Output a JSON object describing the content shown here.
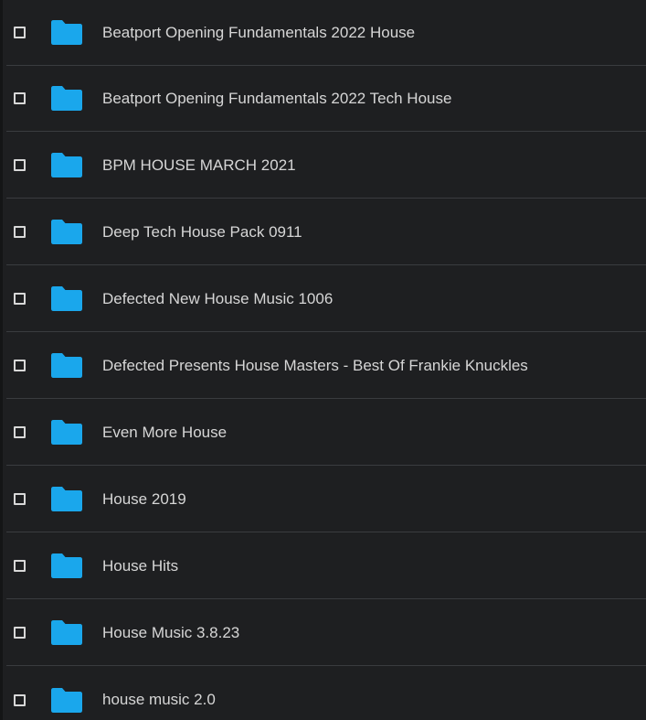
{
  "colors": {
    "background": "#1e1f21",
    "folder": "#1aa7ec",
    "text": "#d6d6d6",
    "divider": "#3a3c3f"
  },
  "list": {
    "items": [
      {
        "name": "Beatport Opening Fundamentals 2022 House",
        "icon": "folder-icon"
      },
      {
        "name": "Beatport Opening Fundamentals 2022 Tech House",
        "icon": "folder-icon"
      },
      {
        "name": "BPM HOUSE MARCH 2021",
        "icon": "folder-icon"
      },
      {
        "name": "Deep Tech House Pack 0911",
        "icon": "folder-icon"
      },
      {
        "name": "Defected New House Music 1006",
        "icon": "folder-icon"
      },
      {
        "name": "Defected Presents House Masters - Best Of Frankie Knuckles",
        "icon": "folder-icon"
      },
      {
        "name": "Even More House",
        "icon": "folder-icon"
      },
      {
        "name": "House 2019",
        "icon": "folder-icon"
      },
      {
        "name": "House Hits",
        "icon": "folder-icon"
      },
      {
        "name": "House Music 3.8.23",
        "icon": "folder-icon"
      },
      {
        "name": "house music 2.0",
        "icon": "folder-icon"
      }
    ]
  }
}
